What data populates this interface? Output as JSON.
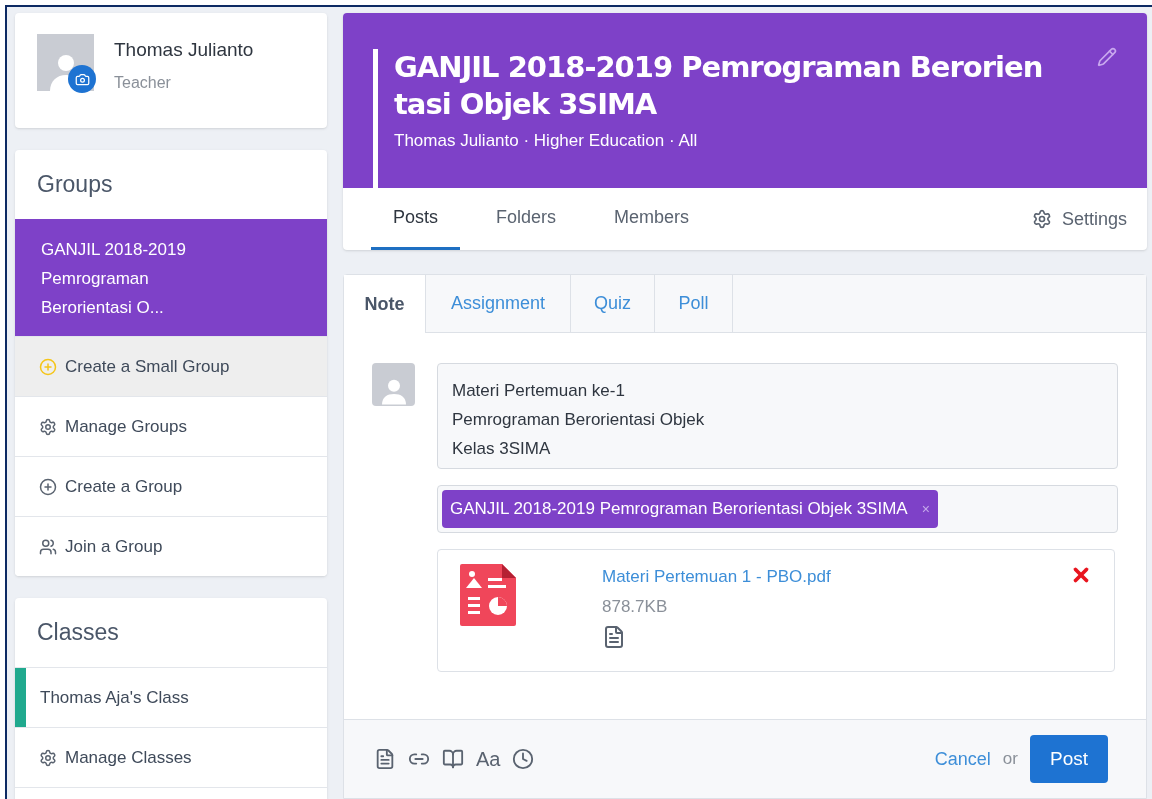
{
  "profile": {
    "name": "Thomas Julianto",
    "role": "Teacher"
  },
  "groups": {
    "title": "Groups",
    "items": [
      {
        "label": "GANJIL 2018-2019 Pemrograman Berorientasi O...",
        "selected": true
      }
    ],
    "actions": [
      {
        "label": "Create a Small Group",
        "kind": "small-group",
        "selected": true
      },
      {
        "label": "Manage Groups",
        "kind": "manage",
        "selected": false
      },
      {
        "label": "Create a Group",
        "kind": "create",
        "selected": false
      },
      {
        "label": "Join a Group",
        "kind": "join",
        "selected": false
      }
    ]
  },
  "classes": {
    "title": "Classes",
    "items": [
      {
        "label": "Thomas Aja's Class",
        "color": "#20a98e"
      }
    ],
    "actions": [
      {
        "label": "Manage Classes",
        "kind": "manage",
        "selected": false
      }
    ]
  },
  "header": {
    "title": "GANJIL 2018-2019 Pemrograman Berorientasi Objek 3SIMA",
    "meta": "Thomas Julianto · Higher Education · All"
  },
  "nav_tabs": [
    {
      "label": "Posts",
      "selected": true
    },
    {
      "label": "Folders",
      "selected": false
    },
    {
      "label": "Members",
      "selected": false
    }
  ],
  "settings": "Settings",
  "composer_tabs": [
    {
      "label": "Note",
      "selected": true
    },
    {
      "label": "Assignment",
      "selected": false
    },
    {
      "label": "Quiz",
      "selected": false
    },
    {
      "label": "Poll",
      "selected": false
    }
  ],
  "note_lines": [
    "Materi Pertemuan ke-1",
    "Pemrograman Berorientasi Objek",
    "Kelas 3SIMA"
  ],
  "recipients": [
    {
      "label": "GANJIL 2018-2019 Pemrograman Berorientasi Objek 3SIMA",
      "remove": "×"
    }
  ],
  "attachment": {
    "name": "Materi Pertemuan 1 - PBO.pdf",
    "size": "878.7KB"
  },
  "toolbar": [
    {
      "kind": "file"
    },
    {
      "kind": "link"
    },
    {
      "kind": "book"
    },
    {
      "kind": "text",
      "label": "Aa"
    },
    {
      "kind": "clock"
    }
  ],
  "cancel": "Cancel",
  "or": "or",
  "post": "Post"
}
